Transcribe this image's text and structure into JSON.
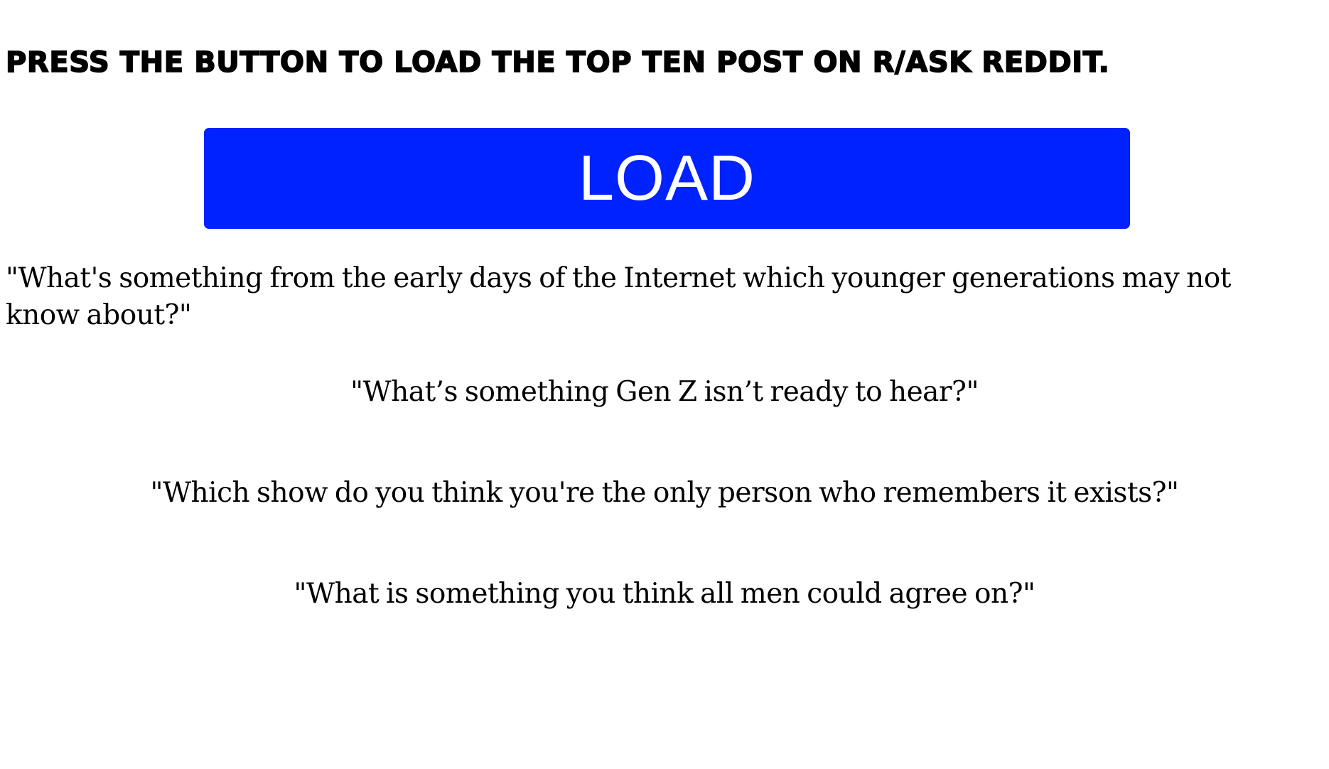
{
  "header": {
    "title": "Press the button to load the top ten post on r/ask reddit."
  },
  "load_button": {
    "label": "LOAD",
    "color": "#0022ff",
    "text_color": "#ffffff"
  },
  "posts": [
    {
      "title": "\"What's something from the early days of the Internet which younger generations may not know about?\""
    },
    {
      "title": "\"What’s something Gen Z isn’t ready to hear?\""
    },
    {
      "title": "\"Which show do you think you're the only person who remembers it exists?\""
    },
    {
      "title": "\"What is something you think all men could agree on?\""
    }
  ]
}
